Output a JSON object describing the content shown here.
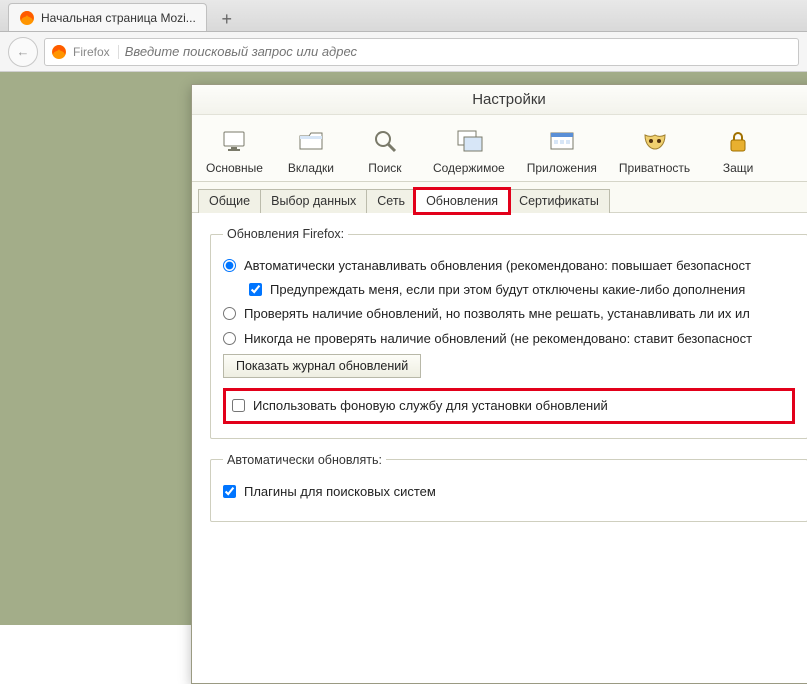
{
  "browser": {
    "tab_title": "Начальная страница Mozi...",
    "newtab_glyph": "+",
    "back_glyph": "←",
    "brand": "Firefox",
    "url_placeholder": "Введите поисковый запрос или адрес"
  },
  "settings": {
    "window_title": "Настройки",
    "toolbar": {
      "items": [
        {
          "label": "Основные"
        },
        {
          "label": "Вкладки"
        },
        {
          "label": "Поиск"
        },
        {
          "label": "Содержимое"
        },
        {
          "label": "Приложения"
        },
        {
          "label": "Приватность"
        },
        {
          "label": "Защи"
        }
      ]
    },
    "subtabs": {
      "items": [
        {
          "label": "Общие"
        },
        {
          "label": "Выбор данных"
        },
        {
          "label": "Сеть"
        },
        {
          "label": "Обновления"
        },
        {
          "label": "Сертификаты"
        }
      ]
    },
    "updates": {
      "group_legend": "Обновления Firefox:",
      "radio_auto": "Автоматически устанавливать обновления (рекомендовано: повышает безопасност",
      "check_warn": "Предупреждать меня, если при этом будут отключены какие-либо дополнения",
      "radio_check": "Проверять наличие обновлений, но позволять мне решать, устанавливать ли их ил",
      "radio_never": "Никогда не проверять наличие обновлений (не рекомендовано: ставит безопасност",
      "history_btn": "Показать журнал обновлений",
      "bg_service": "Использовать фоновую службу для установки обновлений"
    },
    "autoupdate": {
      "group_legend": "Автоматически обновлять:",
      "plugins": "Плагины для поисковых систем"
    }
  }
}
